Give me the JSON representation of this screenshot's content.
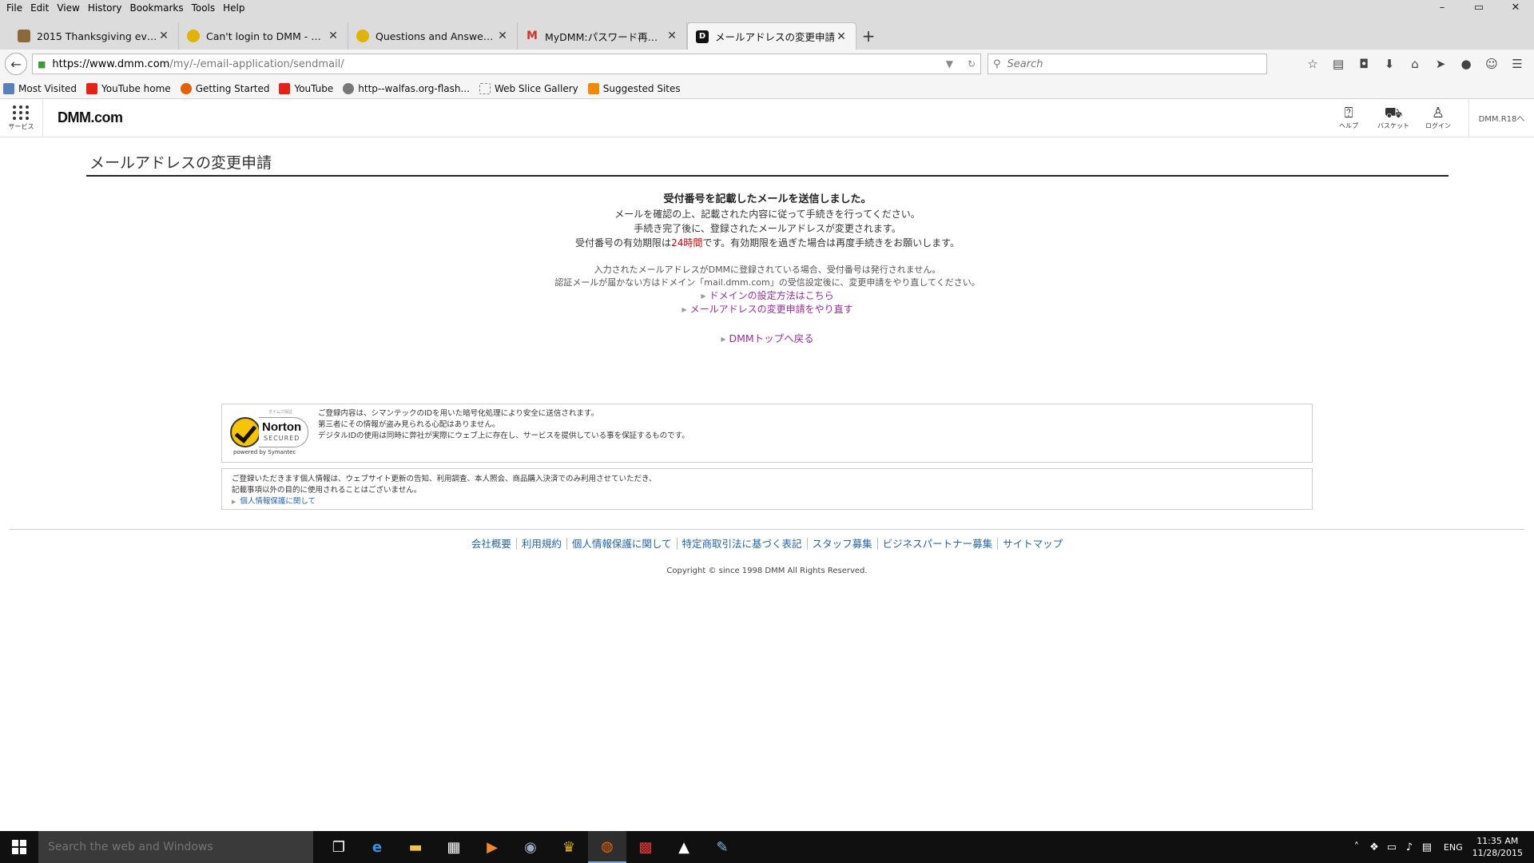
{
  "menubar": {
    "items": [
      "File",
      "Edit",
      "View",
      "History",
      "Bookmarks",
      "Tools",
      "Help"
    ],
    "window_controls": [
      "–",
      "▭",
      "✕"
    ]
  },
  "tabs": [
    {
      "title": "2015 Thanksgiving event -...",
      "icon": "game-icon",
      "color": "#8a6a3a"
    },
    {
      "title": "Can't login to DMM - Kan...",
      "icon": "kancolle-icon",
      "color": "#e0b400"
    },
    {
      "title": "Questions and Answers b...",
      "icon": "kancolle-icon",
      "color": "#e0b400"
    },
    {
      "title": "MyDMM:パスワード再設...",
      "icon": "gmail-icon",
      "color": "#d93025"
    },
    {
      "title": "メールアドレスの変更申請",
      "icon": "dmm-icon",
      "color": "#111111"
    }
  ],
  "navbar": {
    "url_host": "https://www.dmm.com",
    "url_path": "/my/-/email-application/sendmail/",
    "search_placeholder": "Search"
  },
  "bookmarks": [
    {
      "label": "Most Visited",
      "color": "#5b7fb8"
    },
    {
      "label": "YouTube home",
      "color": "#e62117"
    },
    {
      "label": "Getting Started",
      "color": "#e66000"
    },
    {
      "label": "YouTube",
      "color": "#e62117"
    },
    {
      "label": "http--walfas.org-flash...",
      "color": "#777777"
    },
    {
      "label": "Web Slice Gallery",
      "color": "#cccccc"
    },
    {
      "label": "Suggested Sites",
      "color": "#f08a00"
    }
  ],
  "header": {
    "service_label": "サービス",
    "logo": "DMM.com",
    "help_label": "ヘルプ",
    "basket_label": "バスケット",
    "login_label": "ログイン",
    "account": "DMM.R18へ"
  },
  "main": {
    "title": "メールアドレスの変更申請",
    "heading": "受付番号を記載したメールを送信しました。",
    "line1": "メールを確認の上、記載された内容に従って手続きを行ってください。",
    "line2": "手続き完了後に、登録されたメールアドレスが変更されます。",
    "line3_pre": "受付番号の有効期限は",
    "line3_hl": "24時間",
    "line3_post": "です。有効期限を過ぎた場合は再度手続きをお願いします。",
    "note1": "入力されたメールアドレスがDMMに登録されている場合、受付番号は発行されません。",
    "note2": "認証メールが届かない方はドメイン「mail.dmm.com」の受信設定後に、変更申請をやり直してください。",
    "link_domain": "ドメインの設定方法はこちら",
    "link_redo": "メールアドレスの変更申請をやり直す",
    "link_top": "DMMトップへ戻る"
  },
  "norton": {
    "top_label": "ダイムズ保証",
    "name": "Norton",
    "secured": "SECURED",
    "powered": "powered by Symantec",
    "text1": "ご登録内容は、シマンテックのIDを用いた暗号化処理により安全に送信されます。",
    "text2": "第三者にその情報が盗み見られる心配はありません。",
    "text3": "デジタルIDの使用は同時に弊社が実際にウェブ上に存在し、サービスを提供している事を保証するものです。"
  },
  "privacy": {
    "text1": "ご登録いただきます個人情報は、ウェブサイト更新の告知、利用調査、本人照会、商品購入決済でのみ利用させていただき、",
    "text2": "記載事項以外の目的に使用されることはございません。",
    "link": "個人情報保護に関して"
  },
  "footer": {
    "links": [
      "会社概要",
      "利用規約",
      "個人情報保護に関して",
      "特定商取引法に基づく表記",
      "スタッフ募集",
      "ビジネスパートナー募集",
      "サイトマップ"
    ],
    "copyright": "Copyright © since 1998 DMM All Rights Reserved."
  },
  "taskbar": {
    "search_placeholder": "Search the web and Windows",
    "lang": "ENG",
    "time": "11:35 AM",
    "date": "11/28/2015"
  },
  "colors": {
    "link_purple": "#9b2c9b",
    "link_blue": "#2563a8",
    "highlight_red": "#d40000"
  }
}
